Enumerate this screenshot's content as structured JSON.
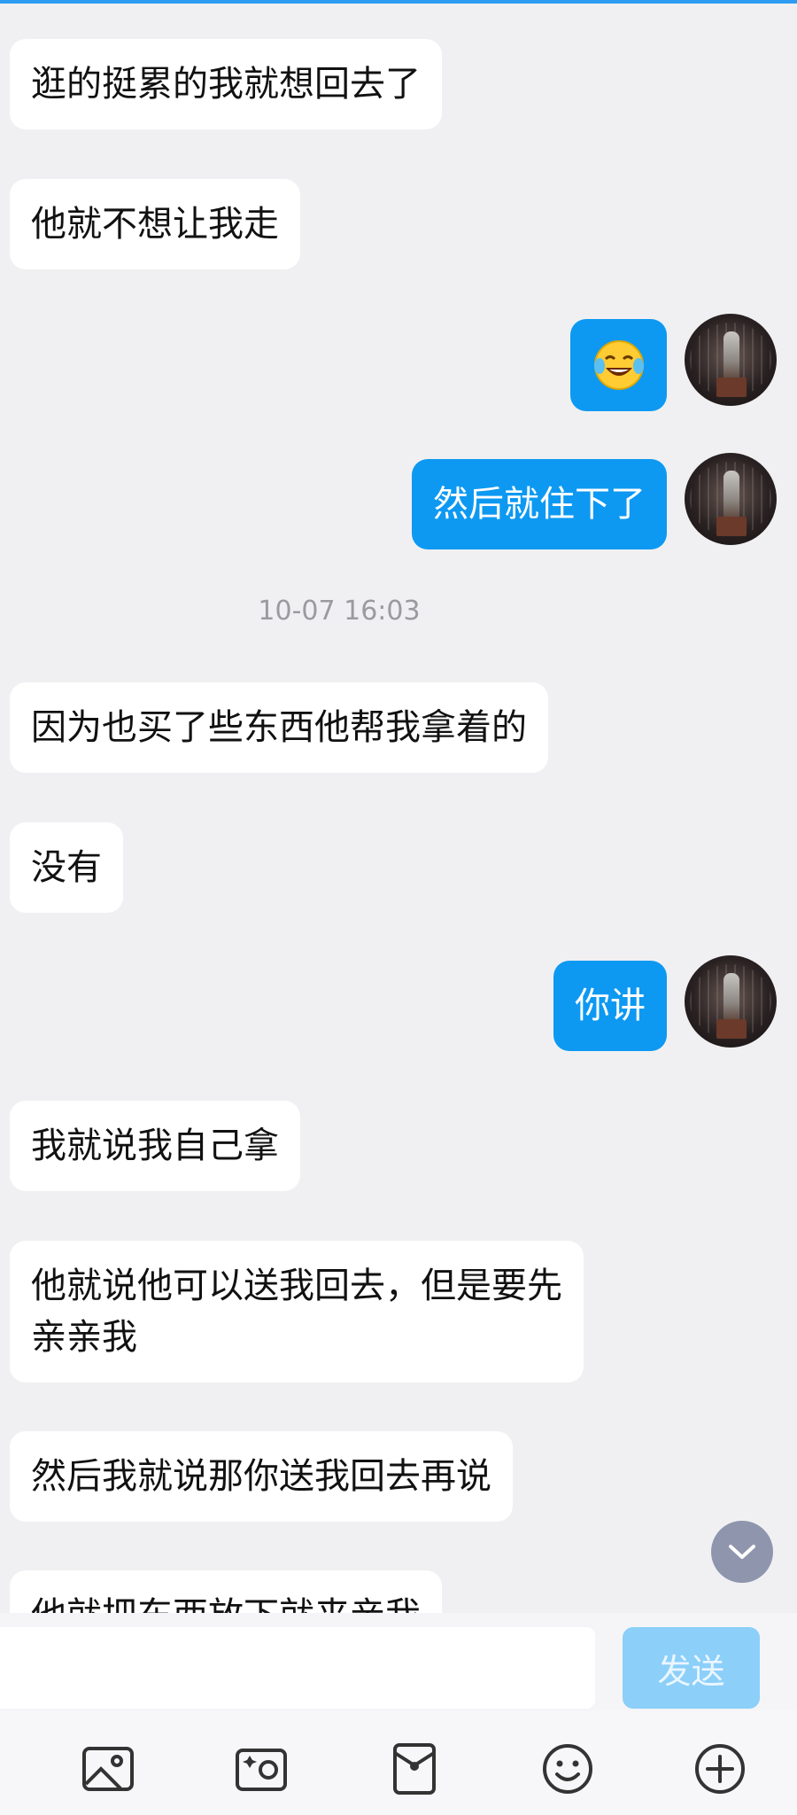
{
  "messages": [
    {
      "side": "in",
      "text": "逛的挺累的我就想回去了"
    },
    {
      "side": "in",
      "text": "他就不想让我走"
    },
    {
      "side": "out",
      "text": "😂",
      "emoji": "face-with-tears-of-joy"
    },
    {
      "side": "out",
      "text": "然后就住下了"
    },
    {
      "timestamp": "10-07 16:03"
    },
    {
      "side": "in",
      "text": "因为也买了些东西他帮我拿着的"
    },
    {
      "side": "in",
      "text": "没有"
    },
    {
      "side": "out",
      "text": "你讲"
    },
    {
      "side": "in",
      "text": "我就说我自己拿"
    },
    {
      "side": "in",
      "text": "他就说他可以送我回去，但是要先\n亲亲我"
    },
    {
      "side": "in",
      "text": "然后我就说那你送我回去再说"
    },
    {
      "side": "in",
      "text": "他就把东西放下就来亲我"
    }
  ],
  "composer": {
    "input_value": "",
    "send_label": "发送"
  },
  "toolbar": {
    "icons": [
      "image-icon",
      "camera-icon",
      "red-packet-icon",
      "emoji-icon",
      "plus-icon"
    ]
  },
  "colors": {
    "incoming_bubble": "#ffffff",
    "outgoing_bubble": "#0d99f2",
    "background": "#f0f0f2",
    "send_button": "#8ccff9",
    "accent_line": "#2d9cf0"
  }
}
